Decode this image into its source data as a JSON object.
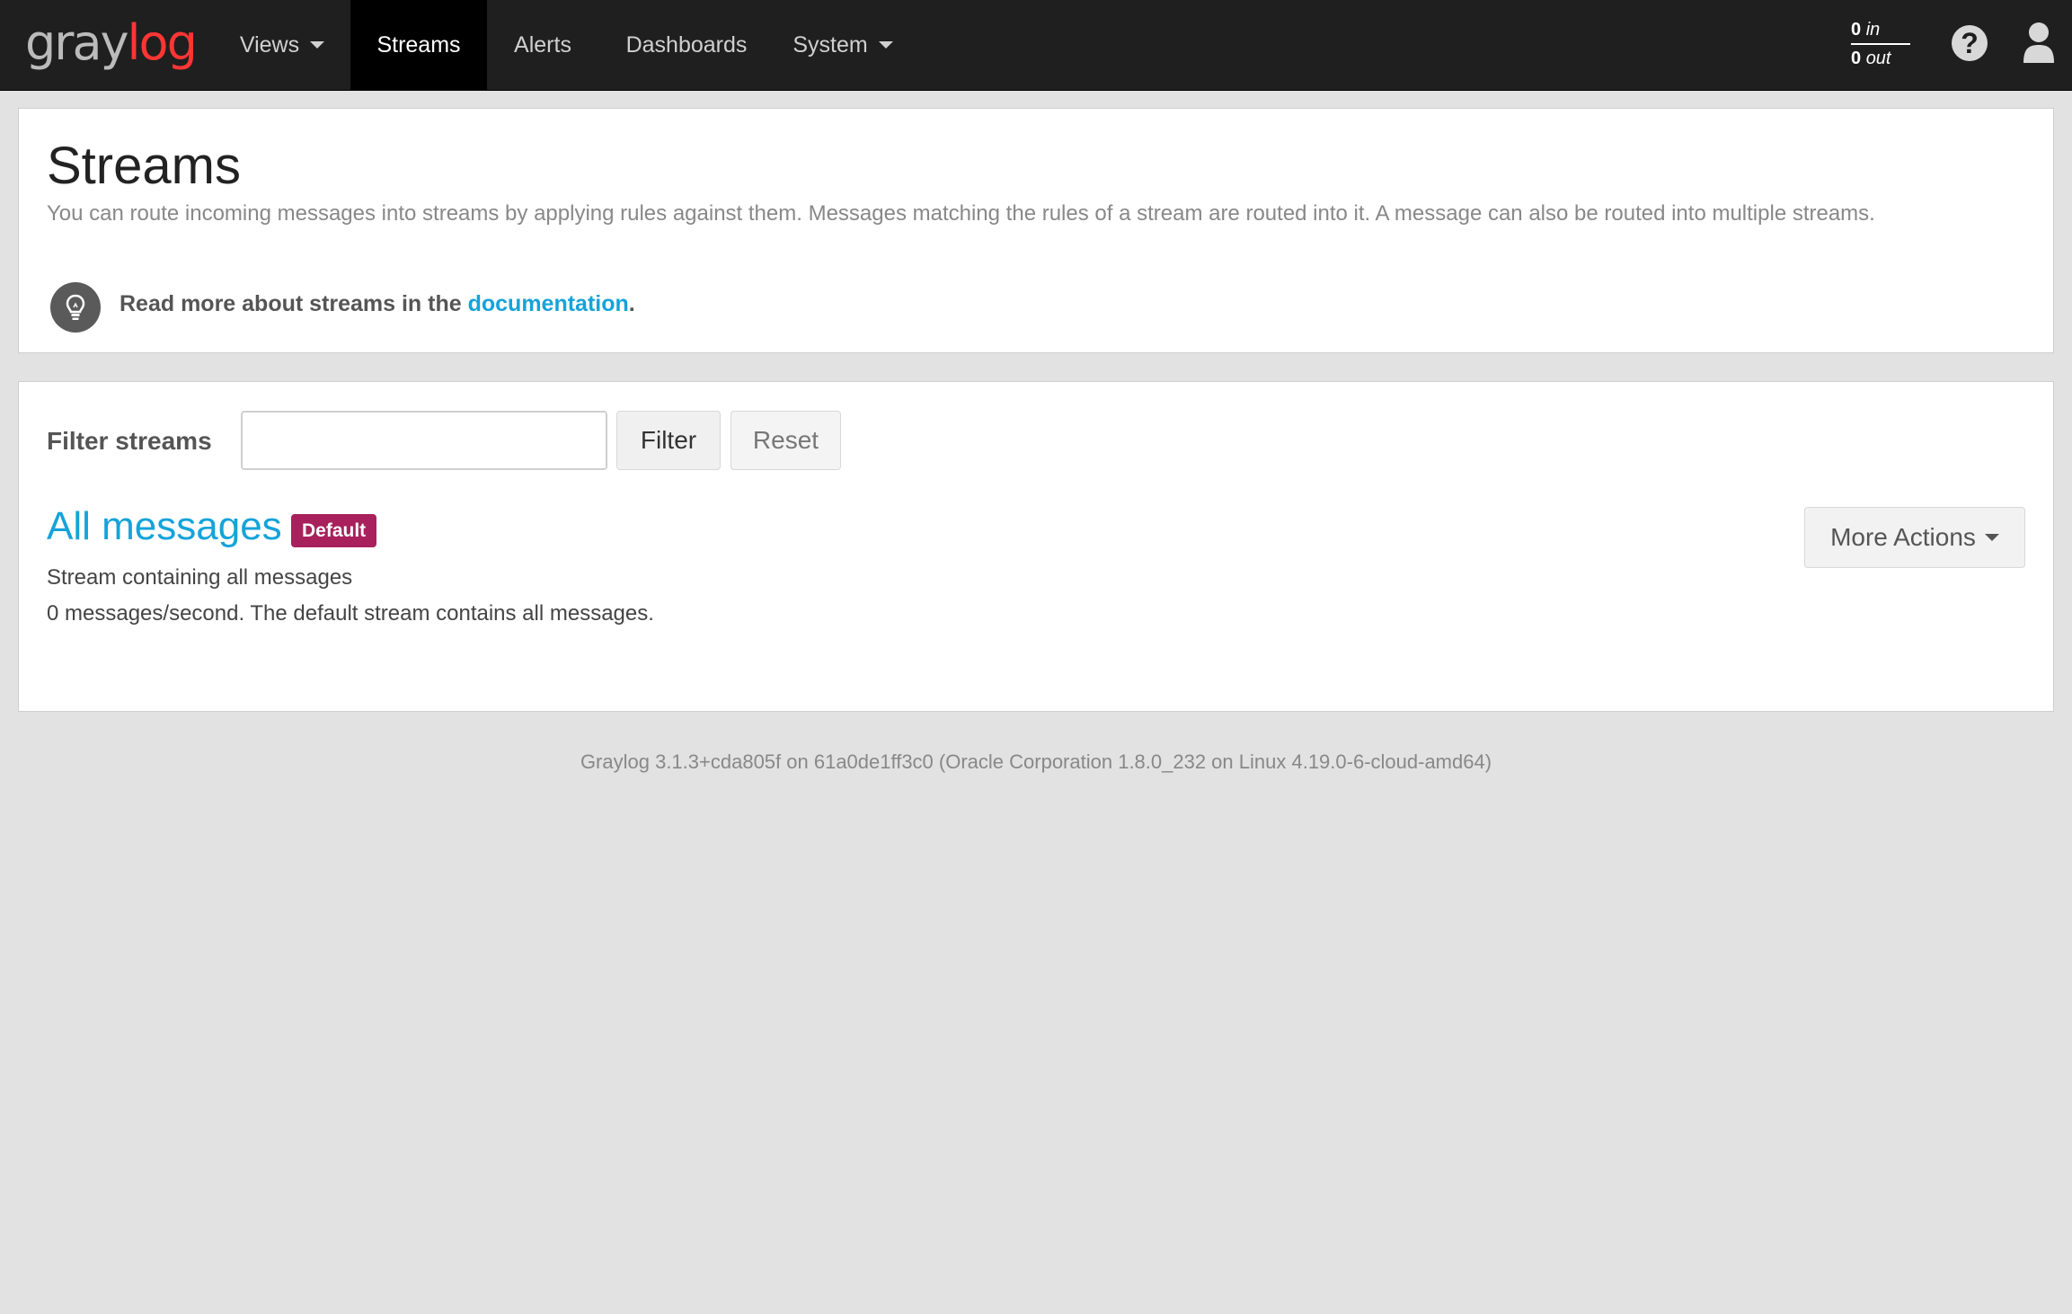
{
  "navbar": {
    "brand": {
      "part1": "gray",
      "part2": "log"
    },
    "items": [
      {
        "label": "Views",
        "dropdown": true
      },
      {
        "label": "Streams",
        "active": true
      },
      {
        "label": "Alerts"
      },
      {
        "label": "Dashboards"
      },
      {
        "label": "System",
        "dropdown": true
      }
    ],
    "throughput": {
      "in_value": "0",
      "in_label": "in",
      "out_value": "0",
      "out_label": "out"
    },
    "help_icon": "question-circle-icon",
    "user_icon": "user-icon"
  },
  "header": {
    "title": "Streams",
    "description": "You can route incoming messages into streams by applying rules against them. Messages matching the rules of a stream are routed into it. A message can also be routed into multiple streams.",
    "doc_prefix": "Read more about streams in the ",
    "doc_link": "documentation",
    "doc_suffix": ".",
    "doc_icon": "lightbulb-icon"
  },
  "filter": {
    "label": "Filter streams",
    "input_value": "",
    "filter_button": "Filter",
    "reset_button": "Reset"
  },
  "streams": [
    {
      "title": "All messages",
      "badge": "Default",
      "description": "Stream containing all messages",
      "rate": "0 messages/second. The default stream contains all messages.",
      "more_actions": "More Actions"
    }
  ],
  "footer": "Graylog 3.1.3+cda805f on 61a0de1ff3c0 (Oracle Corporation 1.8.0_232 on Linux 4.19.0-6-cloud-amd64)",
  "colors": {
    "navbar_bg": "#1f1f1f",
    "link": "#16a3d9",
    "badge": "#a8205c",
    "brand_red": "#ff3633"
  }
}
